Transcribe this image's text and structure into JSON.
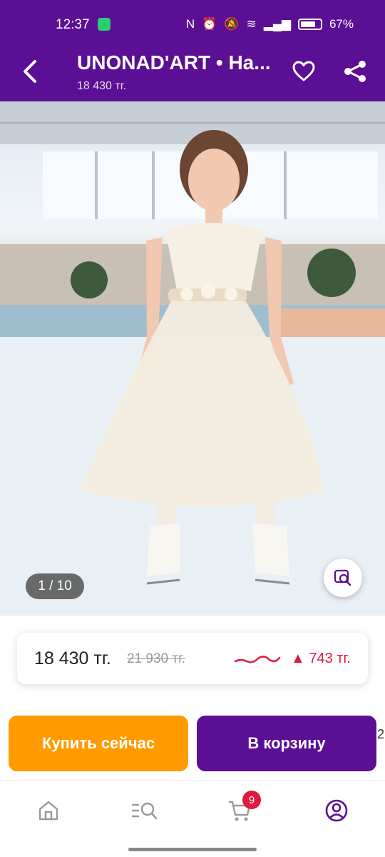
{
  "status_bar": {
    "time": "12:37",
    "battery": "67%"
  },
  "app_bar": {
    "title": "UNONAD'ART • На...",
    "subtitle": "18 430 тг."
  },
  "gallery": {
    "counter": "1 / 10"
  },
  "price": {
    "current": "18 430 тг.",
    "old": "21 930 тг.",
    "change": "▲ 743 тг.",
    "change_color": "#e0193e"
  },
  "actions": {
    "buy_now": "Купить сейчас",
    "add_to_cart": "В корзину",
    "edge_peek": "2"
  },
  "bottom_nav": {
    "items": [
      "home-icon",
      "catalog-search-icon",
      "cart-icon",
      "profile-icon"
    ],
    "cart_count": "9",
    "active": "profile"
  },
  "colors": {
    "brand": "#5b0f95",
    "accent": "#ff9a00",
    "alert": "#e0193e"
  }
}
